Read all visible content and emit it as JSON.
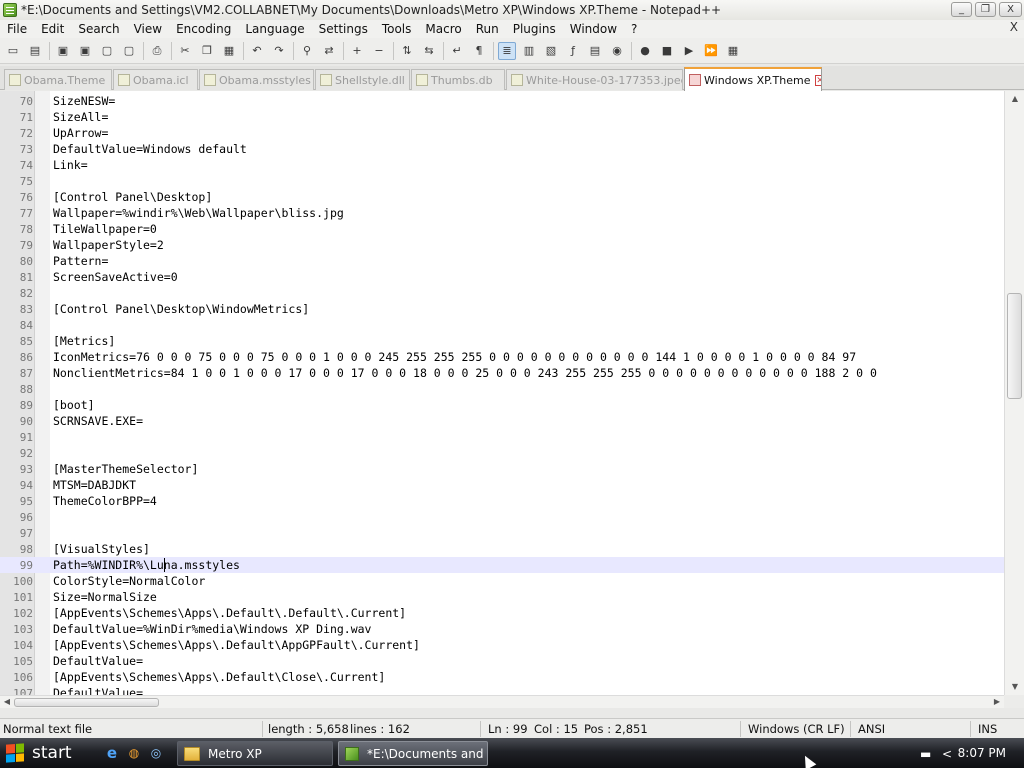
{
  "window": {
    "title": "*E:\\Documents and Settings\\VM2.COLLABNET\\My Documents\\Downloads\\Metro XP\\Windows XP.Theme - Notepad++",
    "controls": {
      "minimize": "_",
      "maximize": "❐",
      "close": "X"
    }
  },
  "menu": {
    "items": [
      "File",
      "Edit",
      "Search",
      "View",
      "Encoding",
      "Language",
      "Settings",
      "Tools",
      "Macro",
      "Run",
      "Plugins",
      "Window",
      "?"
    ],
    "close": "X"
  },
  "toolbar": {
    "buttons": [
      {
        "icon": "new-file-icon",
        "glyph": "▭"
      },
      {
        "icon": "open-file-icon",
        "glyph": "▤"
      },
      {
        "icon": "save-icon",
        "glyph": "▣"
      },
      {
        "icon": "save-all-icon",
        "glyph": "▣"
      },
      {
        "icon": "close-file-icon",
        "glyph": "▢"
      },
      {
        "icon": "close-all-icon",
        "glyph": "▢"
      },
      {
        "icon": "print-icon",
        "glyph": "⎙"
      },
      {
        "icon": "cut-icon",
        "glyph": "✂"
      },
      {
        "icon": "copy-icon",
        "glyph": "❐"
      },
      {
        "icon": "paste-icon",
        "glyph": "▦"
      },
      {
        "icon": "undo-icon",
        "glyph": "↶"
      },
      {
        "icon": "redo-icon",
        "glyph": "↷"
      },
      {
        "icon": "find-icon",
        "glyph": "⚲"
      },
      {
        "icon": "replace-icon",
        "glyph": "⇄"
      },
      {
        "icon": "zoom-in-icon",
        "glyph": "+"
      },
      {
        "icon": "zoom-out-icon",
        "glyph": "−"
      },
      {
        "icon": "sync-vertical-icon",
        "glyph": "⇅"
      },
      {
        "icon": "sync-horizontal-icon",
        "glyph": "⇆"
      },
      {
        "icon": "word-wrap-icon",
        "glyph": "↵"
      },
      {
        "icon": "show-all-chars-icon",
        "glyph": "¶"
      },
      {
        "icon": "indent-guide-icon",
        "glyph": "≣",
        "selected": true
      },
      {
        "icon": "user-language-icon",
        "glyph": "▥"
      },
      {
        "icon": "doc-map-icon",
        "glyph": "▧"
      },
      {
        "icon": "function-list-icon",
        "glyph": "ƒ"
      },
      {
        "icon": "folder-workspace-icon",
        "glyph": "▤"
      },
      {
        "icon": "monitoring-icon",
        "glyph": "◉"
      },
      {
        "icon": "record-macro-icon",
        "glyph": "●"
      },
      {
        "icon": "stop-record-icon",
        "glyph": "■"
      },
      {
        "icon": "play-macro-icon",
        "glyph": "▶"
      },
      {
        "icon": "run-macro-multiple-icon",
        "glyph": "⏩"
      },
      {
        "icon": "save-macro-icon",
        "glyph": "▦"
      }
    ]
  },
  "tabs": [
    {
      "label": "Obama.Theme",
      "active": false
    },
    {
      "label": "Obama.icl",
      "active": false
    },
    {
      "label": "Obama.msstyles",
      "active": false
    },
    {
      "label": "Shellstyle.dll",
      "active": false
    },
    {
      "label": "Thumbs.db",
      "active": false
    },
    {
      "label": "White-House-03-177353.jpeg",
      "active": false
    },
    {
      "label": "Windows XP.Theme",
      "active": true
    }
  ],
  "editor": {
    "current_line": 99,
    "lines": [
      {
        "n": "70",
        "text": "SizeNESW="
      },
      {
        "n": "71",
        "text": "SizeAll="
      },
      {
        "n": "72",
        "text": "UpArrow="
      },
      {
        "n": "73",
        "text": "DefaultValue=Windows default"
      },
      {
        "n": "74",
        "text": "Link="
      },
      {
        "n": "75",
        "text": ""
      },
      {
        "n": "76",
        "text": "[Control Panel\\Desktop]"
      },
      {
        "n": "77",
        "text": "Wallpaper=%windir%\\Web\\Wallpaper\\bliss.jpg"
      },
      {
        "n": "78",
        "text": "TileWallpaper=0"
      },
      {
        "n": "79",
        "text": "WallpaperStyle=2"
      },
      {
        "n": "80",
        "text": "Pattern="
      },
      {
        "n": "81",
        "text": "ScreenSaveActive=0"
      },
      {
        "n": "82",
        "text": ""
      },
      {
        "n": "83",
        "text": "[Control Panel\\Desktop\\WindowMetrics]"
      },
      {
        "n": "84",
        "text": ""
      },
      {
        "n": "85",
        "text": "[Metrics]"
      },
      {
        "n": "86",
        "text": "IconMetrics=76 0 0 0 75 0 0 0 75 0 0 0 1 0 0 0 245 255 255 255 0 0 0 0 0 0 0 0 0 0 0 0 144 1 0 0 0 0 1 0 0 0 0 84 97"
      },
      {
        "n": "87",
        "text": "NonclientMetrics=84 1 0 0 1 0 0 0 17 0 0 0 17 0 0 0 18 0 0 0 25 0 0 0 243 255 255 255 0 0 0 0 0 0 0 0 0 0 0 0 188 2 0 0"
      },
      {
        "n": "88",
        "text": ""
      },
      {
        "n": "89",
        "text": "[boot]"
      },
      {
        "n": "90",
        "text": "SCRNSAVE.EXE="
      },
      {
        "n": "91",
        "text": ""
      },
      {
        "n": "92",
        "text": ""
      },
      {
        "n": "93",
        "text": "[MasterThemeSelector]"
      },
      {
        "n": "94",
        "text": "MTSM=DABJDKT"
      },
      {
        "n": "95",
        "text": "ThemeColorBPP=4"
      },
      {
        "n": "96",
        "text": ""
      },
      {
        "n": "97",
        "text": ""
      },
      {
        "n": "98",
        "text": "[VisualStyles]"
      },
      {
        "n": "99",
        "text": "Path=%WINDIR%\\Luna.msstyles"
      },
      {
        "n": "100",
        "text": "ColorStyle=NormalColor"
      },
      {
        "n": "101",
        "text": "Size=NormalSize"
      },
      {
        "n": "102",
        "text": "[AppEvents\\Schemes\\Apps\\.Default\\.Default\\.Current]"
      },
      {
        "n": "103",
        "text": "DefaultValue=%WinDir%media\\Windows XP Ding.wav"
      },
      {
        "n": "104",
        "text": "[AppEvents\\Schemes\\Apps\\.Default\\AppGPFault\\.Current]"
      },
      {
        "n": "105",
        "text": "DefaultValue="
      },
      {
        "n": "106",
        "text": "[AppEvents\\Schemes\\Apps\\.Default\\Close\\.Current]"
      },
      {
        "n": "107",
        "text": "DefaultValue="
      }
    ],
    "scroll": {
      "up": "▲",
      "down": "▼",
      "left": "◀",
      "right": "▶",
      "vertical_position": 0.4,
      "horizontal_position": 0.0
    }
  },
  "status": {
    "doc_type": "Normal text file",
    "length": "length : 5,658",
    "lines": "lines : 162",
    "ln": "Ln : 99",
    "col": "Col : 15",
    "pos": "Pos : 2,851",
    "eol": "Windows (CR LF)",
    "encoding": "ANSI",
    "mode": "INS"
  },
  "taskbar": {
    "start": "start",
    "quick_launch": [
      {
        "icon": "internet-explorer-icon",
        "glyph": "e"
      },
      {
        "icon": "firefox-icon",
        "glyph": "◍"
      },
      {
        "icon": "media-player-icon",
        "glyph": "◎"
      }
    ],
    "tasks": [
      {
        "label": "Metro XP",
        "icon": "folder-icon",
        "active": false
      },
      {
        "label": "*E:\\Documents and ...",
        "icon": "notepad-icon",
        "active": true
      }
    ],
    "tray": {
      "keyboard": "▬",
      "arrow": "<",
      "time": "8:07 PM"
    }
  },
  "colors": {
    "active_tab_accent": "#f0a23a",
    "current_line_highlight": "#e8e8ff",
    "gutter": "#e4e4e4",
    "taskbar": "#1f2126"
  }
}
